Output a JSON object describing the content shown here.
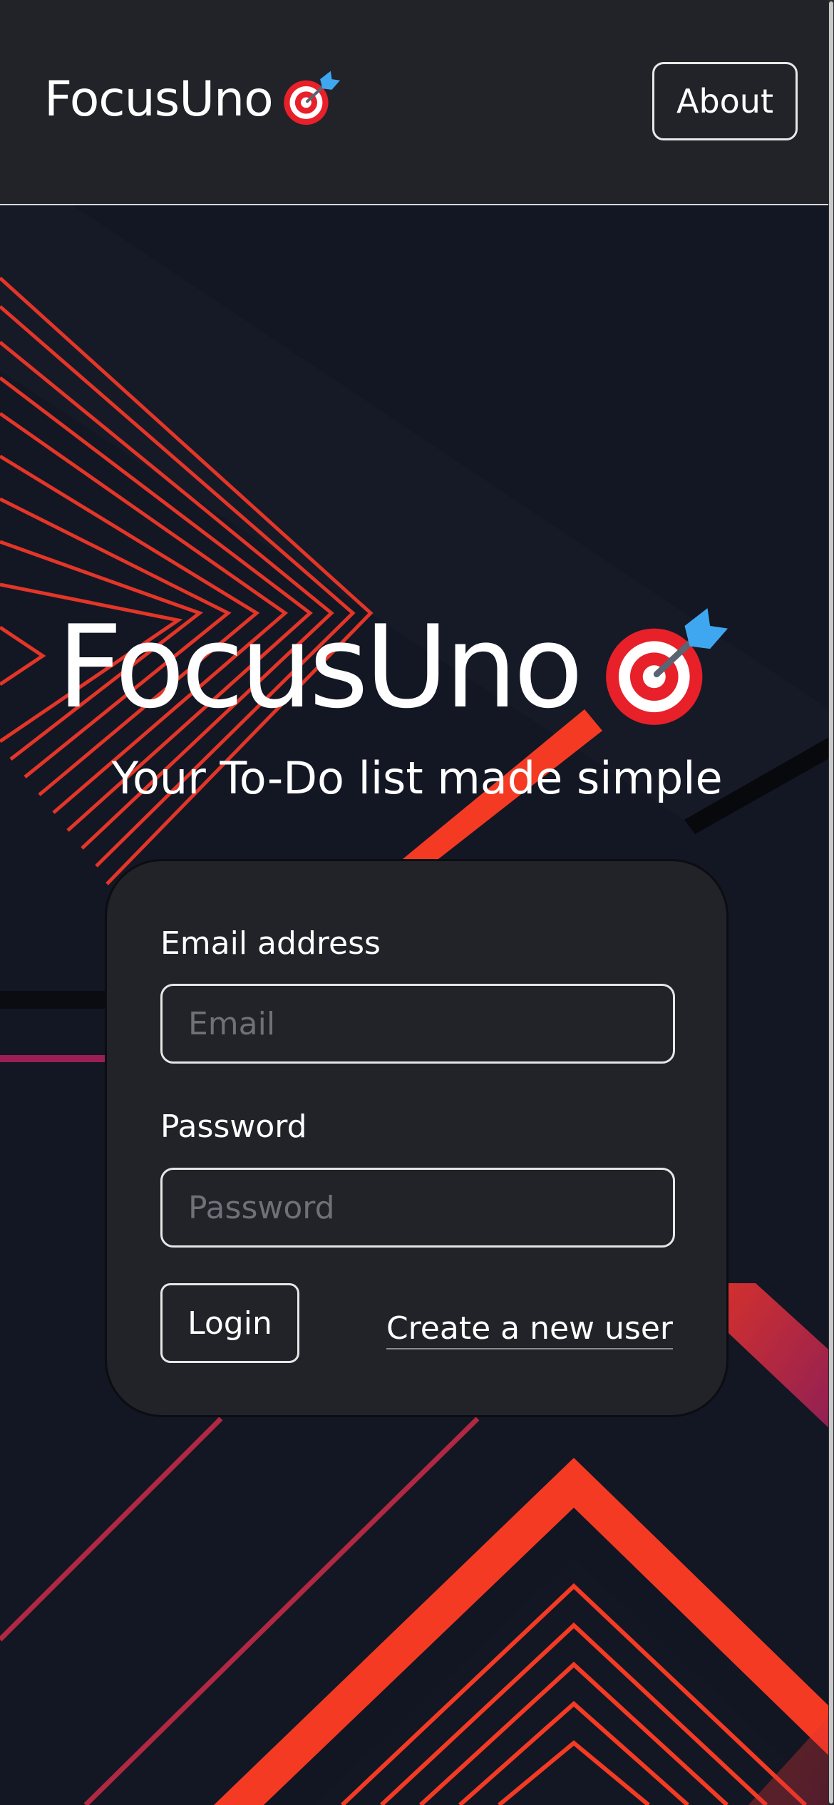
{
  "navbar": {
    "brand": "FocusUno",
    "brand_icon": "dart-target-icon",
    "about_label": "About"
  },
  "hero": {
    "title": "FocusUno",
    "title_icon": "dart-target-icon",
    "subtitle": "Your To-Do list made simple"
  },
  "login_form": {
    "email_label": "Email address",
    "email_placeholder": "Email",
    "email_value": "",
    "password_label": "Password",
    "password_placeholder": "Password",
    "password_value": "",
    "login_label": "Login",
    "create_user_label": "Create a new user"
  },
  "colors": {
    "navbar_bg": "#212328",
    "page_bg": "#121723",
    "card_bg": "#212328",
    "accent_red": "#f53a24",
    "accent_magenta": "#a8204e",
    "text": "#ffffff"
  }
}
